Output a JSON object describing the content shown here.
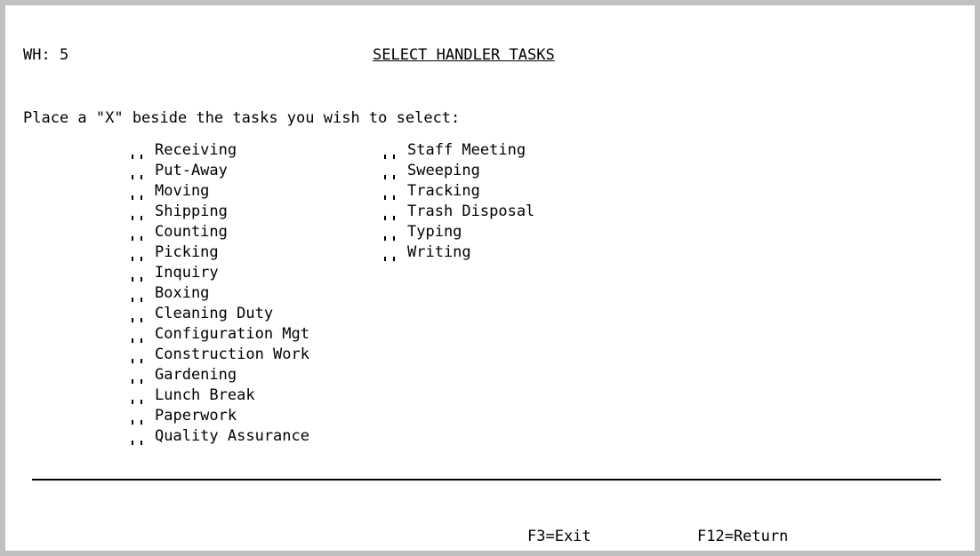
{
  "header": {
    "warehouse": "WH: 5",
    "title": "SELECT HANDLER TASKS"
  },
  "instruction": "Place a \"X\" beside the tasks you wish to select:",
  "tasks_left": [
    {
      "label": "Receiving",
      "selected": ""
    },
    {
      "label": "Put-Away",
      "selected": ""
    },
    {
      "label": "Moving",
      "selected": ""
    },
    {
      "label": "Shipping",
      "selected": ""
    },
    {
      "label": "Counting",
      "selected": ""
    },
    {
      "label": "Picking",
      "selected": ""
    },
    {
      "label": "Inquiry",
      "selected": ""
    },
    {
      "label": "Boxing",
      "selected": ""
    },
    {
      "label": "Cleaning Duty",
      "selected": ""
    },
    {
      "label": "Configuration Mgt",
      "selected": ""
    },
    {
      "label": "Construction Work",
      "selected": ""
    },
    {
      "label": "Gardening",
      "selected": ""
    },
    {
      "label": "Lunch Break",
      "selected": ""
    },
    {
      "label": "Paperwork",
      "selected": ""
    },
    {
      "label": "Quality Assurance",
      "selected": ""
    }
  ],
  "tasks_right": [
    {
      "label": "Staff Meeting",
      "selected": ""
    },
    {
      "label": "Sweeping",
      "selected": ""
    },
    {
      "label": "Tracking",
      "selected": ""
    },
    {
      "label": "Trash Disposal",
      "selected": ""
    },
    {
      "label": "Typing",
      "selected": ""
    },
    {
      "label": "Writing",
      "selected": ""
    }
  ],
  "function_keys": {
    "exit": "F3=Exit",
    "return": "F12=Return"
  }
}
